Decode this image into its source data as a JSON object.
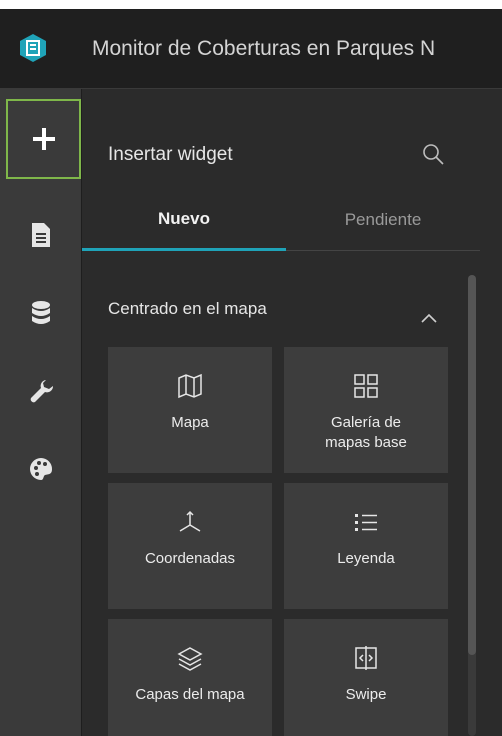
{
  "header": {
    "title": "Monitor de Coberturas en Parques N"
  },
  "panel": {
    "title": "Insertar widget",
    "tabs": [
      {
        "label": "Nuevo",
        "active": true
      },
      {
        "label": "Pendiente",
        "active": false
      }
    ],
    "section": {
      "title": "Centrado en el mapa"
    },
    "widgets": [
      {
        "label": "Mapa",
        "icon": "map-icon"
      },
      {
        "label": "Galería de mapas base",
        "icon": "grid-icon"
      },
      {
        "label": "Coordenadas",
        "icon": "axes-icon"
      },
      {
        "label": "Leyenda",
        "icon": "list-icon"
      },
      {
        "label": "Capas del mapa",
        "icon": "layers-icon"
      },
      {
        "label": "Swipe",
        "icon": "swipe-icon"
      }
    ]
  },
  "colors": {
    "accent_tab": "#1fa3b8",
    "selected_outline": "#7fb74a",
    "logo": "#1fa3b8"
  }
}
